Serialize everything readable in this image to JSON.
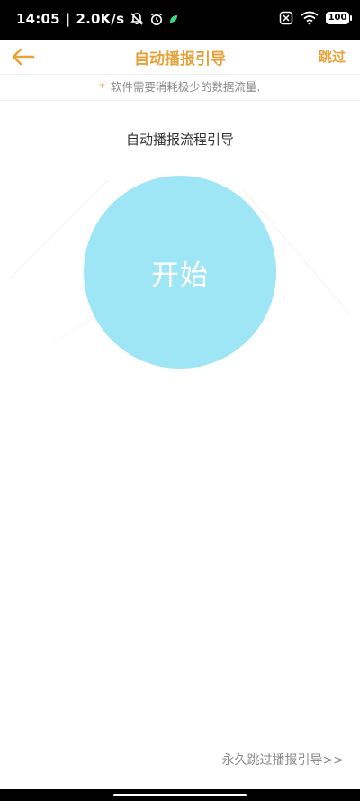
{
  "status_bar": {
    "time": "14:05",
    "separator": "|",
    "network_speed": "2.0K/s",
    "battery_level": "100",
    "icons": [
      "dnd-icon",
      "alarm-icon",
      "leaf-icon",
      "sim-icon",
      "wifi-icon",
      "battery-icon"
    ]
  },
  "header": {
    "title": "自动播报引导",
    "skip_label": "跳过",
    "back_icon": "back-arrow-icon"
  },
  "info": {
    "asterisk": "*",
    "text": "软件需要消耗极少的数据流量."
  },
  "main": {
    "section_title": "自动播报流程引导",
    "start_label": "开始"
  },
  "footer": {
    "permanent_skip": "永久跳过播报引导>>"
  },
  "colors": {
    "accent": "#e5a33b",
    "circle": "#9ee6f6",
    "muted_text": "#8a8a8a"
  }
}
